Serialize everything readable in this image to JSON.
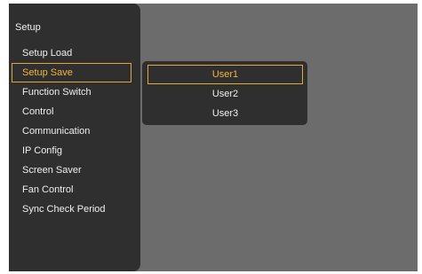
{
  "colors": {
    "panel_background": "#2f2f2f",
    "screen_background": "#6c6c6c",
    "text": "#f0f0f0",
    "highlight": "#f4b43c",
    "highlight_border": "#e0a83a"
  },
  "setup_menu": {
    "title": "Setup",
    "selected_index": 1,
    "items": [
      {
        "label": "Setup Load"
      },
      {
        "label": "Setup Save"
      },
      {
        "label": "Function Switch"
      },
      {
        "label": "Control"
      },
      {
        "label": "Communication"
      },
      {
        "label": "IP Config"
      },
      {
        "label": "Screen Saver"
      },
      {
        "label": "Fan Control"
      },
      {
        "label": "Sync Check Period"
      }
    ]
  },
  "setup_save_submenu": {
    "selected_index": 0,
    "items": [
      {
        "label": "User1"
      },
      {
        "label": "User2"
      },
      {
        "label": "User3"
      }
    ]
  }
}
